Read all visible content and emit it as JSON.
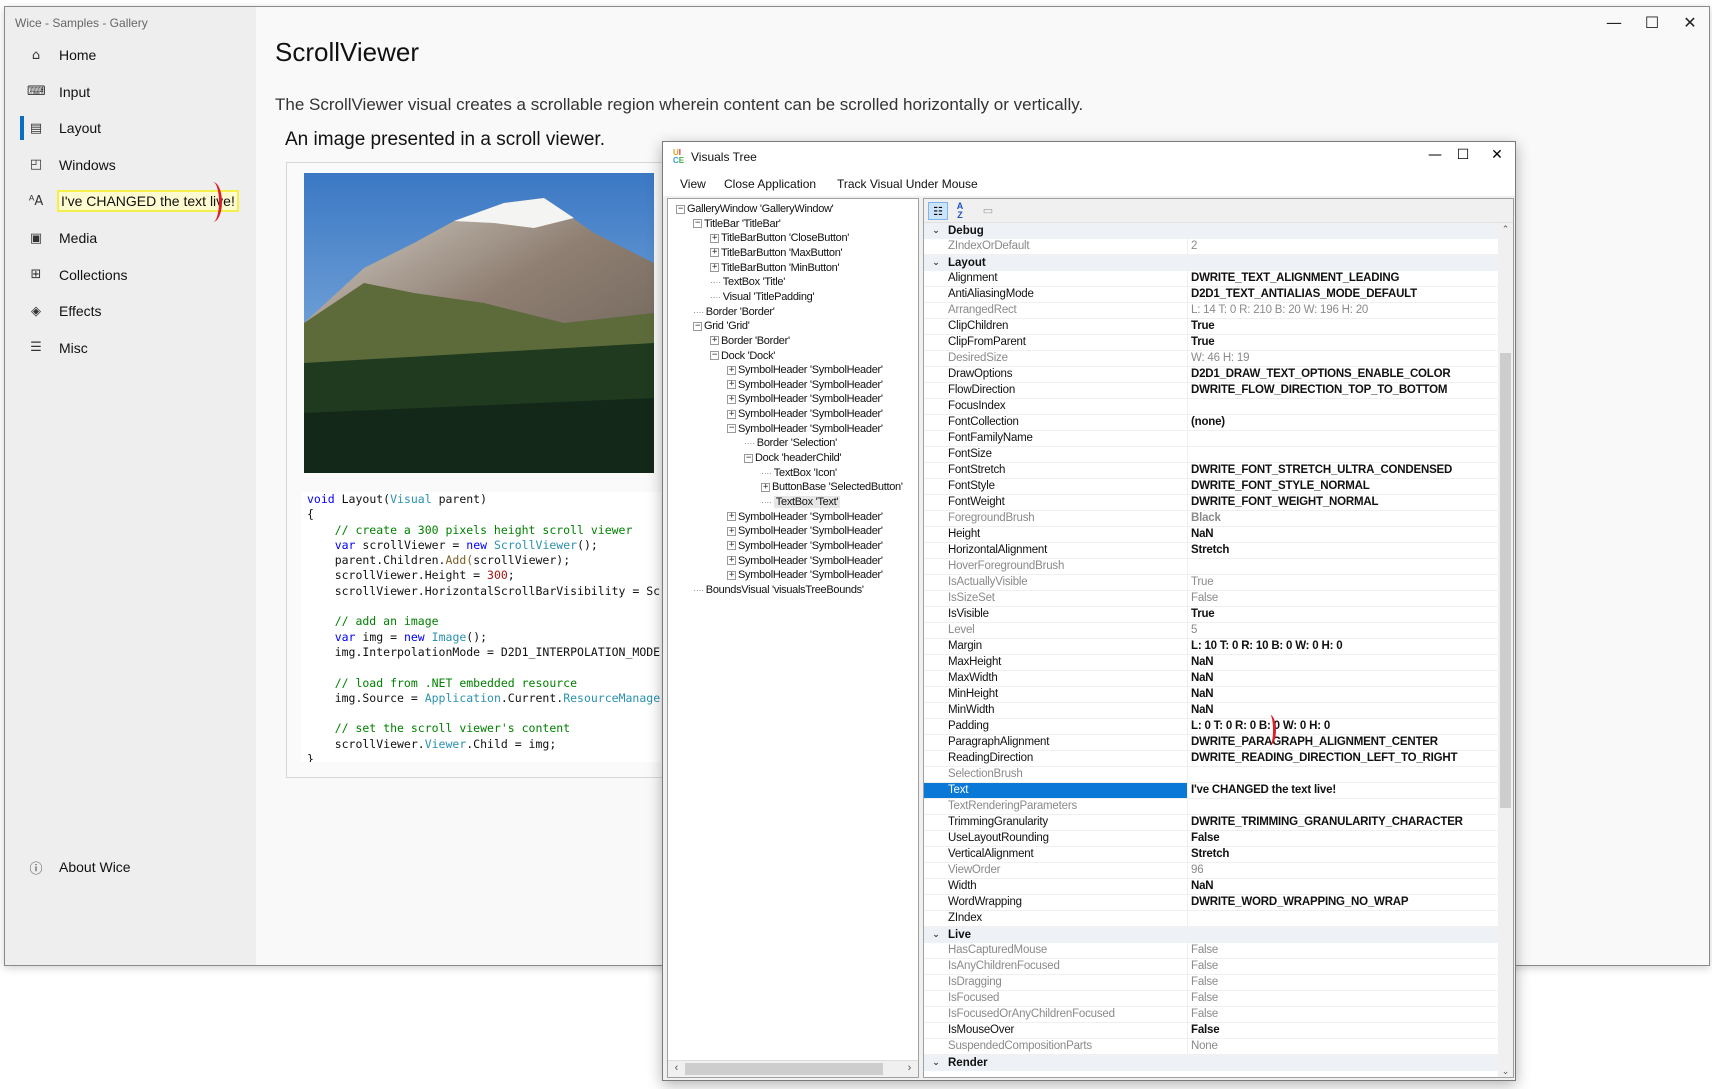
{
  "gallery": {
    "app_title": "Wice - Samples - Gallery",
    "nav": [
      {
        "label": "Home",
        "icon": "home-icon",
        "glyph": "⌂"
      },
      {
        "label": "Input",
        "icon": "keyboard-icon",
        "glyph": "⌨"
      },
      {
        "label": "Layout",
        "icon": "layout-icon",
        "glyph": "▤",
        "selected": true
      },
      {
        "label": "Windows",
        "icon": "windows-icon",
        "glyph": "◰"
      },
      {
        "label": "I've CHANGED the text live!",
        "icon": "font-size-icon",
        "glyph": "ᴬA"
      },
      {
        "label": "Media",
        "icon": "media-icon",
        "glyph": "▣"
      },
      {
        "label": "Collections",
        "icon": "collections-icon",
        "glyph": "⊞"
      },
      {
        "label": "Effects",
        "icon": "effects-icon",
        "glyph": "◈"
      },
      {
        "label": "Misc",
        "icon": "misc-icon",
        "glyph": "☰"
      }
    ],
    "about": {
      "label": "About Wice",
      "glyph": "ⓘ"
    },
    "window_controls": {
      "minimize": "—",
      "maximize": "☐",
      "close": "✕"
    },
    "page_title": "ScrollViewer",
    "page_description": "The ScrollViewer visual creates a scrollable region wherein content can be scrolled horizontally or vertically.",
    "section_title": "An image presented in a scroll viewer.",
    "code_lines": [
      "void Layout(Visual parent)",
      "{",
      "    // create a 300 pixels height scroll viewer",
      "    var scrollViewer = new ScrollViewer();",
      "    parent.Children.Add(scrollViewer);",
      "    scrollViewer.Height = 300;",
      "    scrollViewer.HorizontalScrollBarVisibility = Sc",
      "",
      "    // add an image",
      "    var img = new Image();",
      "    img.InterpolationMode = D2D1_INTERPOLATION_MODE",
      "",
      "    // load from .NET embedded resource",
      "    img.Source = Application.Current.ResourceManage",
      "",
      "    // set the scroll viewer's content",
      "    scrollViewer.Viewer.Child = img;",
      "}"
    ]
  },
  "visuals_tree": {
    "title": "Visuals Tree",
    "window_controls": {
      "minimize": "—",
      "maximize": "☐",
      "close": "✕"
    },
    "menu": [
      "View",
      "Close Application",
      "Track Visual Under Mouse"
    ],
    "tree": [
      {
        "depth": 0,
        "exp": "-",
        "text": "GalleryWindow 'GalleryWindow'"
      },
      {
        "depth": 1,
        "exp": "-",
        "text": "TitleBar 'TitleBar'"
      },
      {
        "depth": 2,
        "exp": "+",
        "text": "TitleBarButton 'CloseButton'"
      },
      {
        "depth": 2,
        "exp": "+",
        "text": "TitleBarButton 'MaxButton'"
      },
      {
        "depth": 2,
        "exp": "+",
        "text": "TitleBarButton 'MinButton'"
      },
      {
        "depth": 2,
        "exp": "",
        "text": "TextBox 'Title'"
      },
      {
        "depth": 2,
        "exp": "",
        "text": "Visual 'TitlePadding'"
      },
      {
        "depth": 1,
        "exp": "",
        "text": "Border 'Border'"
      },
      {
        "depth": 1,
        "exp": "-",
        "text": "Grid 'Grid'"
      },
      {
        "depth": 2,
        "exp": "+",
        "text": "Border 'Border'"
      },
      {
        "depth": 2,
        "exp": "-",
        "text": "Dock 'Dock'"
      },
      {
        "depth": 3,
        "exp": "+",
        "text": "SymbolHeader 'SymbolHeader'"
      },
      {
        "depth": 3,
        "exp": "+",
        "text": "SymbolHeader 'SymbolHeader'"
      },
      {
        "depth": 3,
        "exp": "+",
        "text": "SymbolHeader 'SymbolHeader'"
      },
      {
        "depth": 3,
        "exp": "+",
        "text": "SymbolHeader 'SymbolHeader'"
      },
      {
        "depth": 3,
        "exp": "-",
        "text": "SymbolHeader 'SymbolHeader'"
      },
      {
        "depth": 4,
        "exp": "",
        "text": "Border 'Selection'"
      },
      {
        "depth": 4,
        "exp": "-",
        "text": "Dock 'headerChild'"
      },
      {
        "depth": 5,
        "exp": "",
        "text": "TextBox 'Icon'"
      },
      {
        "depth": 5,
        "exp": "+",
        "text": "ButtonBase 'SelectedButton'"
      },
      {
        "depth": 5,
        "exp": "",
        "text": "TextBox 'Text'",
        "selected": true
      },
      {
        "depth": 3,
        "exp": "+",
        "text": "SymbolHeader 'SymbolHeader'"
      },
      {
        "depth": 3,
        "exp": "+",
        "text": "SymbolHeader 'SymbolHeader'"
      },
      {
        "depth": 3,
        "exp": "+",
        "text": "SymbolHeader 'SymbolHeader'"
      },
      {
        "depth": 3,
        "exp": "+",
        "text": "SymbolHeader 'SymbolHeader'"
      },
      {
        "depth": 3,
        "exp": "+",
        "text": "SymbolHeader 'SymbolHeader'"
      },
      {
        "depth": 1,
        "exp": "",
        "text": "BoundsVisual 'visualsTreeBounds'"
      }
    ],
    "properties": [
      {
        "category": "Debug"
      },
      {
        "name": "ZIndexOrDefault",
        "value": "2",
        "readonly": true
      },
      {
        "category": "Layout"
      },
      {
        "name": "Alignment",
        "value": "DWRITE_TEXT_ALIGNMENT_LEADING",
        "bold": true
      },
      {
        "name": "AntiAliasingMode",
        "value": "D2D1_TEXT_ANTIALIAS_MODE_DEFAULT",
        "bold": true
      },
      {
        "name": "ArrangedRect",
        "value": "L: 14 T: 0 R: 210 B: 20 W: 196 H: 20",
        "readonly": true
      },
      {
        "name": "ClipChildren",
        "value": "True",
        "bold": true
      },
      {
        "name": "ClipFromParent",
        "value": "True",
        "bold": true
      },
      {
        "name": "DesiredSize",
        "value": "W: 46 H: 19",
        "readonly": true
      },
      {
        "name": "DrawOptions",
        "value": "D2D1_DRAW_TEXT_OPTIONS_ENABLE_COLOR",
        "bold": true
      },
      {
        "name": "FlowDirection",
        "value": "DWRITE_FLOW_DIRECTION_TOP_TO_BOTTOM",
        "bold": true
      },
      {
        "name": "FocusIndex",
        "value": ""
      },
      {
        "name": "FontCollection",
        "value": "(none)",
        "bold": true
      },
      {
        "name": "FontFamilyName",
        "value": ""
      },
      {
        "name": "FontSize",
        "value": ""
      },
      {
        "name": "FontStretch",
        "value": "DWRITE_FONT_STRETCH_ULTRA_CONDENSED",
        "bold": true
      },
      {
        "name": "FontStyle",
        "value": "DWRITE_FONT_STYLE_NORMAL",
        "bold": true
      },
      {
        "name": "FontWeight",
        "value": "DWRITE_FONT_WEIGHT_NORMAL",
        "bold": true
      },
      {
        "name": "ForegroundBrush",
        "value": "Black",
        "readonly": true,
        "bold": true
      },
      {
        "name": "Height",
        "value": "NaN",
        "bold": true
      },
      {
        "name": "HorizontalAlignment",
        "value": "Stretch",
        "bold": true
      },
      {
        "name": "HoverForegroundBrush",
        "value": "",
        "readonly": true
      },
      {
        "name": "IsActuallyVisible",
        "value": "True",
        "readonly": true
      },
      {
        "name": "IsSizeSet",
        "value": "False",
        "readonly": true
      },
      {
        "name": "IsVisible",
        "value": "True",
        "bold": true
      },
      {
        "name": "Level",
        "value": "5",
        "readonly": true
      },
      {
        "name": "Margin",
        "value": "L: 10 T: 0 R: 10 B: 0 W: 0 H: 0",
        "bold": true
      },
      {
        "name": "MaxHeight",
        "value": "NaN",
        "bold": true
      },
      {
        "name": "MaxWidth",
        "value": "NaN",
        "bold": true
      },
      {
        "name": "MinHeight",
        "value": "NaN",
        "bold": true
      },
      {
        "name": "MinWidth",
        "value": "NaN",
        "bold": true
      },
      {
        "name": "Padding",
        "value": "L: 0 T: 0 R: 0 B: 0 W: 0 H: 0",
        "bold": true
      },
      {
        "name": "ParagraphAlignment",
        "value": "DWRITE_PARAGRAPH_ALIGNMENT_CENTER",
        "bold": true
      },
      {
        "name": "ReadingDirection",
        "value": "DWRITE_READING_DIRECTION_LEFT_TO_RIGHT",
        "bold": true
      },
      {
        "name": "SelectionBrush",
        "value": "",
        "readonly": true
      },
      {
        "name": "Text",
        "value": "I've CHANGED the text live!",
        "bold": true,
        "selected": true
      },
      {
        "name": "TextRenderingParameters",
        "value": "",
        "readonly": true
      },
      {
        "name": "TrimmingGranularity",
        "value": "DWRITE_TRIMMING_GRANULARITY_CHARACTER",
        "bold": true
      },
      {
        "name": "UseLayoutRounding",
        "value": "False",
        "bold": true
      },
      {
        "name": "VerticalAlignment",
        "value": "Stretch",
        "bold": true
      },
      {
        "name": "ViewOrder",
        "value": "96",
        "readonly": true
      },
      {
        "name": "Width",
        "value": "NaN",
        "bold": true
      },
      {
        "name": "WordWrapping",
        "value": "DWRITE_WORD_WRAPPING_NO_WRAP",
        "bold": true
      },
      {
        "name": "ZIndex",
        "value": ""
      },
      {
        "category": "Live"
      },
      {
        "name": "HasCapturedMouse",
        "value": "False",
        "readonly": true
      },
      {
        "name": "IsAnyChildrenFocused",
        "value": "False",
        "readonly": true
      },
      {
        "name": "IsDragging",
        "value": "False",
        "readonly": true
      },
      {
        "name": "IsFocused",
        "value": "False",
        "readonly": true
      },
      {
        "name": "IsFocusedOrAnyChildrenFocused",
        "value": "False",
        "readonly": true
      },
      {
        "name": "IsMouseOver",
        "value": "False",
        "bold": true
      },
      {
        "name": "SuspendedCompositionParts",
        "value": "None",
        "readonly": true
      },
      {
        "category": "Render"
      }
    ]
  },
  "colors": {
    "accent": "#0a78d7",
    "nav_selected": "#0a6fc2",
    "highlight": "#f5ef4a",
    "annotation": "#d9202a"
  }
}
